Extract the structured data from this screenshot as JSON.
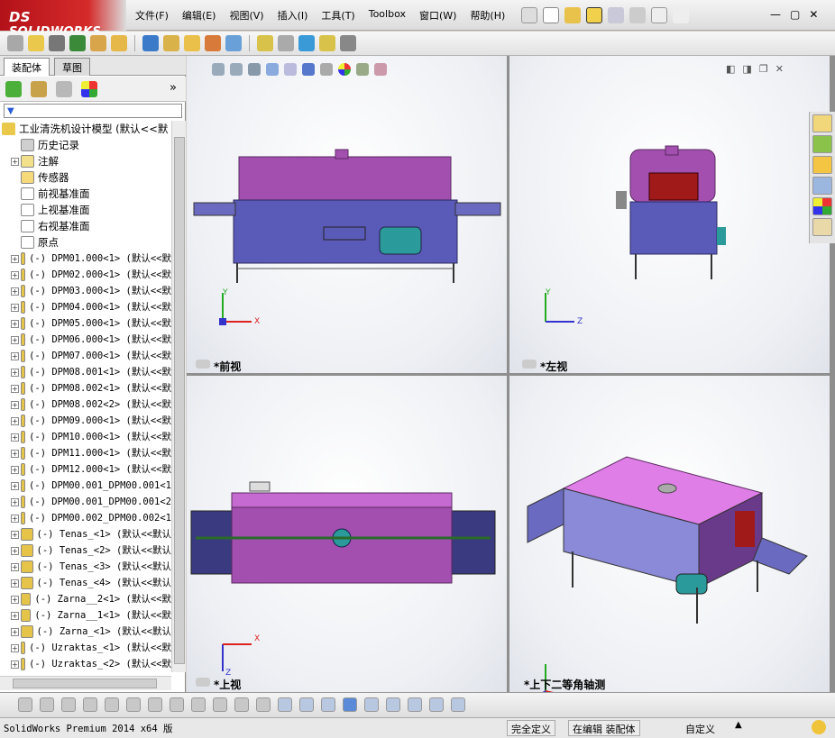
{
  "app": {
    "brand": "SOLIDWORKS",
    "brand_ds": "DS"
  },
  "menu": [
    "文件(F)",
    "编辑(E)",
    "视图(V)",
    "插入(I)",
    "工具(T)",
    "Toolbox",
    "窗口(W)",
    "帮助(H)"
  ],
  "panel": {
    "tabs": [
      "装配体",
      "草图"
    ],
    "root": "工业清洗机设计模型  (默认<<默",
    "items": [
      {
        "label": "历史记录",
        "icon": "history-icon",
        "plus": false,
        "mono": false
      },
      {
        "label": "注解",
        "icon": "annotation-icon",
        "plus": true,
        "mono": false
      },
      {
        "label": "传感器",
        "icon": "sensor-icon",
        "plus": false,
        "mono": false
      },
      {
        "label": "前视基准面",
        "icon": "plane-icon",
        "plus": false,
        "mono": false
      },
      {
        "label": "上视基准面",
        "icon": "plane-icon",
        "plus": false,
        "mono": false
      },
      {
        "label": "右视基准面",
        "icon": "plane-icon",
        "plus": false,
        "mono": false
      },
      {
        "label": "原点",
        "icon": "origin-icon",
        "plus": false,
        "mono": false
      },
      {
        "label": "(-) DPM01.000<1> (默认<<默",
        "icon": "part-icon",
        "plus": true,
        "mono": true
      },
      {
        "label": "(-) DPM02.000<1> (默认<<默",
        "icon": "part-icon",
        "plus": true,
        "mono": true
      },
      {
        "label": "(-) DPM03.000<1> (默认<<默",
        "icon": "part-icon",
        "plus": true,
        "mono": true
      },
      {
        "label": "(-) DPM04.000<1> (默认<<默",
        "icon": "part-icon",
        "plus": true,
        "mono": true
      },
      {
        "label": "(-) DPM05.000<1> (默认<<默",
        "icon": "part-icon",
        "plus": true,
        "mono": true
      },
      {
        "label": "(-) DPM06.000<1> (默认<<默",
        "icon": "part-icon",
        "plus": true,
        "mono": true
      },
      {
        "label": "(-) DPM07.000<1> (默认<<默",
        "icon": "part-icon",
        "plus": true,
        "mono": true
      },
      {
        "label": "(-) DPM08.001<1> (默认<<默",
        "icon": "part-icon",
        "plus": true,
        "mono": true
      },
      {
        "label": "(-) DPM08.002<1> (默认<<默",
        "icon": "part-icon",
        "plus": true,
        "mono": true
      },
      {
        "label": "(-) DPM08.002<2> (默认<<默",
        "icon": "part-icon",
        "plus": true,
        "mono": true
      },
      {
        "label": "(-) DPM09.000<1> (默认<<默",
        "icon": "part-icon",
        "plus": true,
        "mono": true
      },
      {
        "label": "(-) DPM10.000<1> (默认<<默",
        "icon": "part-icon",
        "plus": true,
        "mono": true
      },
      {
        "label": "(-) DPM11.000<1> (默认<<默",
        "icon": "part-icon",
        "plus": true,
        "mono": true
      },
      {
        "label": "(-) DPM12.000<1> (默认<<默",
        "icon": "part-icon",
        "plus": true,
        "mono": true
      },
      {
        "label": "(-) DPM00.001_DPM00.001<1",
        "icon": "part-icon",
        "plus": true,
        "mono": true
      },
      {
        "label": "(-) DPM00.001_DPM00.001<2",
        "icon": "part-icon",
        "plus": true,
        "mono": true
      },
      {
        "label": "(-) DPM00.002_DPM00.002<1",
        "icon": "part-icon",
        "plus": true,
        "mono": true
      },
      {
        "label": "(-) Tenas_<1> (默认<<默认",
        "icon": "part-icon",
        "plus": true,
        "mono": true
      },
      {
        "label": "(-) Tenas_<2> (默认<<默认",
        "icon": "part-icon",
        "plus": true,
        "mono": true
      },
      {
        "label": "(-) Tenas_<3> (默认<<默认",
        "icon": "part-icon",
        "plus": true,
        "mono": true
      },
      {
        "label": "(-) Tenas_<4> (默认<<默认",
        "icon": "part-icon",
        "plus": true,
        "mono": true
      },
      {
        "label": "(-) Zarna__2<1> (默认<<默",
        "icon": "part-icon",
        "plus": true,
        "mono": true
      },
      {
        "label": "(-) Zarna__1<1> (默认<<默",
        "icon": "part-icon",
        "plus": true,
        "mono": true
      },
      {
        "label": "(-) Zarna_<1> (默认<<默认",
        "icon": "part-icon",
        "plus": true,
        "mono": true
      },
      {
        "label": "(-) Uzraktas_<1> (默认<<默",
        "icon": "part-icon",
        "plus": true,
        "mono": true
      },
      {
        "label": "(-) Uzraktas_<2> (默认<<默",
        "icon": "part-icon",
        "plus": true,
        "mono": true
      }
    ]
  },
  "viewports": {
    "front": "*前视",
    "left": "*左视",
    "top": "*上视",
    "iso": "*上下二等角轴测"
  },
  "axes": {
    "x": "X",
    "y": "Y",
    "z": "Z"
  },
  "status": {
    "app": "SolidWorks Premium 2014 x64 版",
    "defined": "完全定义",
    "editing": "在编辑 装配体",
    "custom": "自定义"
  },
  "colors": {
    "housing": "#a34fb0",
    "body": "#5a5ab8",
    "frame": "#4a4a7a",
    "accent": "#2a9a9a"
  }
}
